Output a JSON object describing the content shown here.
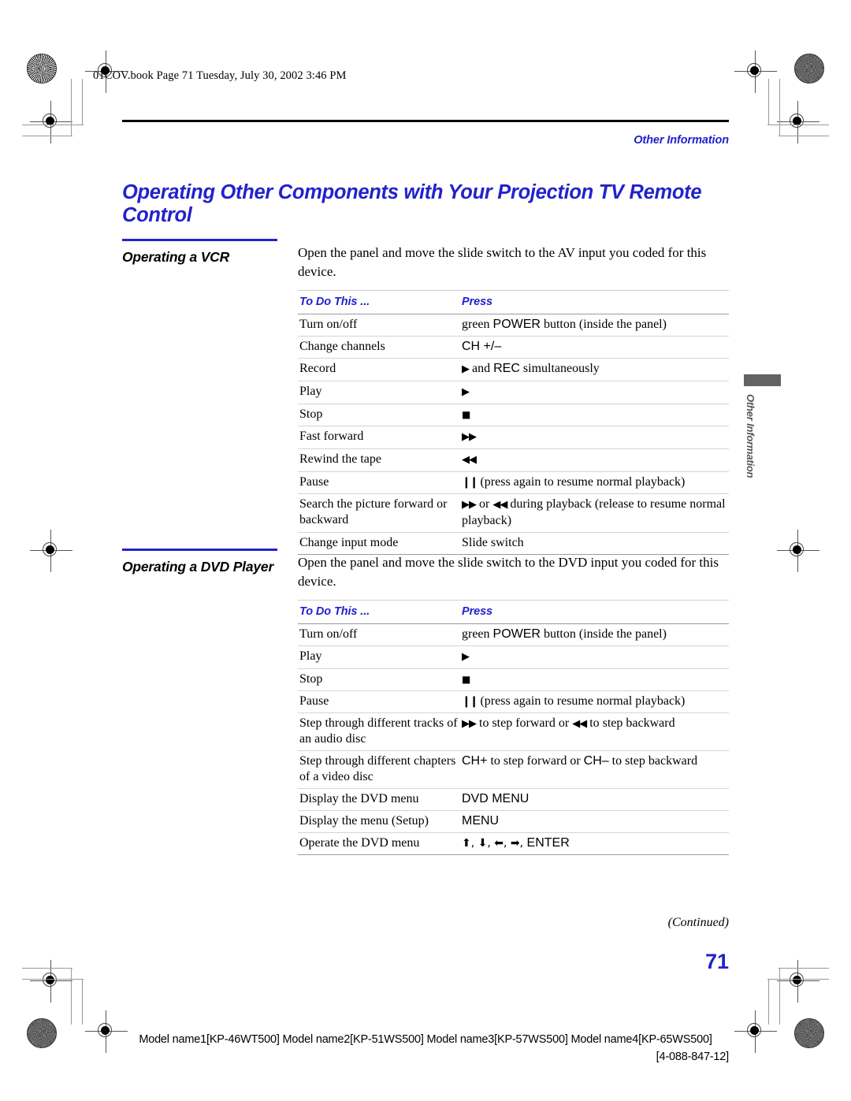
{
  "print_marks": {
    "file_info": "01COV.book  Page 71  Tuesday, July 30, 2002  3:46 PM"
  },
  "header": {
    "running_head": "Other Information",
    "title": "Operating Other Components with Your Projection TV Remote Control"
  },
  "thumb_tab": {
    "label": "Other Information"
  },
  "sections": [
    {
      "heading": "Operating a VCR",
      "intro": "Open the panel and move the slide switch to the AV input you coded for this device.",
      "columns": [
        "To Do This ...",
        "Press"
      ],
      "rows": [
        {
          "todo": "Turn on/off",
          "press_pre": "green ",
          "press_btn": "POWER",
          "press_post": " button (inside the panel)"
        },
        {
          "todo": "Change channels",
          "press_pre": "",
          "press_btn": "CH +/–",
          "press_post": ""
        },
        {
          "todo": "Record",
          "press_pre": "",
          "press_glyph": "▶",
          "press_btn": "",
          "press_post": " and ",
          "press_btn2": "REC",
          "press_post2": " simultaneously"
        },
        {
          "todo": "Play",
          "press_glyph": "▶"
        },
        {
          "todo": "Stop",
          "press_glyph": "■"
        },
        {
          "todo": "Fast forward",
          "press_glyph": "▶▶"
        },
        {
          "todo": "Rewind the tape",
          "press_glyph": "◀◀"
        },
        {
          "todo": "Pause",
          "press_glyph": "❙❙",
          "press_post": " (press again to resume normal playback)"
        },
        {
          "todo": "Search the picture forward or backward",
          "press_glyph": "▶▶",
          "press_post": " or ",
          "press_glyph2": "◀◀",
          "press_post2": " during playback (release to resume normal playback)"
        },
        {
          "todo": "Change input mode",
          "press_post": "Slide switch"
        }
      ]
    },
    {
      "heading": "Operating a DVD Player",
      "intro": "Open the panel and move the slide switch to the DVD input you coded for this device.",
      "columns": [
        "To Do This ...",
        "Press"
      ],
      "rows": [
        {
          "todo": "Turn on/off",
          "press_pre": "green ",
          "press_btn": "POWER",
          "press_post": " button (inside the panel)"
        },
        {
          "todo": "Play",
          "press_glyph": "▶"
        },
        {
          "todo": "Stop",
          "press_glyph": "■"
        },
        {
          "todo": "Pause",
          "press_glyph": "❙❙",
          "press_post": " (press again to resume normal playback)"
        },
        {
          "todo": "Step through different tracks of an audio disc",
          "press_glyph": "▶▶",
          "press_post": " to step forward or ",
          "press_glyph2": "◀◀",
          "press_post2": " to step backward"
        },
        {
          "todo": "Step through different chapters of a video disc",
          "press_btn": "CH+",
          "press_post": " to step forward or ",
          "press_btn2": "CH–",
          "press_post2": " to step backward"
        },
        {
          "todo": "Display the DVD menu",
          "press_btn": "DVD MENU"
        },
        {
          "todo": "Display the menu (Setup)",
          "press_btn": "MENU"
        },
        {
          "todo": "Operate the DVD menu",
          "press_arrows": "⬆, ⬇, ⬅, ➡, ",
          "press_btn": "ENTER"
        }
      ]
    }
  ],
  "footer": {
    "continued": "(Continued)",
    "page_number": "71",
    "model_line": "Model name1[KP-46WT500] Model name2[KP-51WS500] Model name3[KP-57WS500] Model name4[KP-65WS500]",
    "part_number": "[4-088-847-12]"
  },
  "colors": {
    "accent_blue": "#2222cc",
    "rule_black": "#000000",
    "tab_gray": "#636363"
  }
}
